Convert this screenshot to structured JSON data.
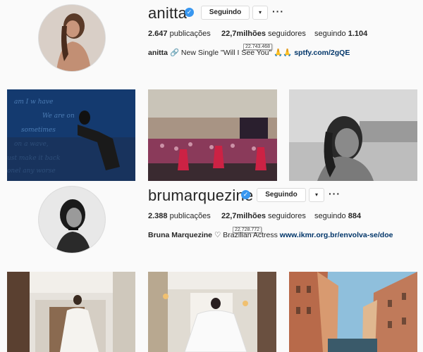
{
  "profiles": [
    {
      "username": "anitta",
      "follow_label": "Seguindo",
      "dropdown_glyph": "▾",
      "more_glyph": "···",
      "verified_glyph": "✓",
      "stats": {
        "posts_value": "2.647",
        "posts_label": "publicações",
        "followers_value": "22,7milhões",
        "followers_label": "seguidores",
        "following_label": "seguindo",
        "following_value": "1.104"
      },
      "tooltip": "22.743.468",
      "bio": {
        "name": "anitta",
        "emoji_text": "🔗",
        "text": " New Single \"Will I See You\" 🙏🙏 ",
        "link": "sptfy.com/2gQE"
      },
      "photos": [
        "stage-blue-text",
        "stadium-concert",
        "bw-portrait"
      ]
    },
    {
      "username": "bruma​rquezine",
      "follow_label": "Seguindo",
      "dropdown_glyph": "▾",
      "more_glyph": "···",
      "verified_glyph": "✓",
      "stats": {
        "posts_value": "2.388",
        "posts_label": "publicações",
        "followers_value": "22,7milhões",
        "followers_label": "seguidores",
        "following_label": "seguindo",
        "following_value": "884"
      },
      "tooltip": "22.728.772",
      "bio": {
        "name": "Bruna Marquezine",
        "heart": " ♡ ",
        "text": "Brazilian Actress ",
        "link": "www.ikmr.org.br/envolva-se/doe"
      },
      "photos": [
        "hallway-white-dress",
        "hallway-back",
        "venice-canal"
      ]
    }
  ],
  "colors": {
    "background": "#fafafa",
    "verified": "#3897f0",
    "link": "#003569"
  }
}
